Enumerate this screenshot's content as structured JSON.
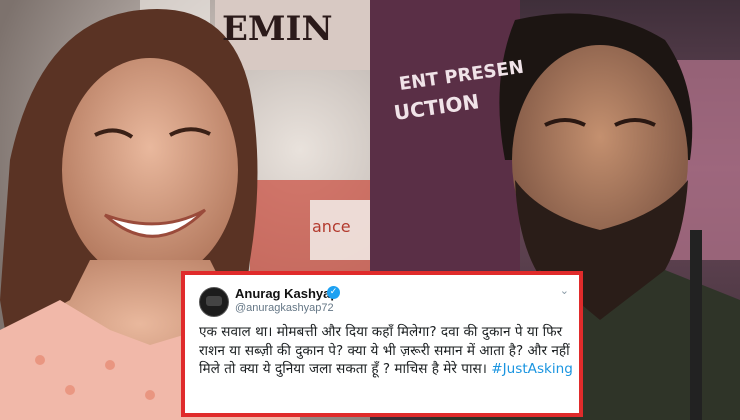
{
  "photo": {
    "background_banner_left": "EMIN",
    "background_banner_mid": "ENT PRESEN",
    "background_banner_low": "UCTION",
    "background_sign": "ance"
  },
  "tweet": {
    "author_name": "Anurag Kashyap",
    "verified_icon": "verified-badge-icon",
    "handle": "@anuragkashyap72",
    "text": "एक सवाल था। मोमबत्ती और दिया कहाँ मिलेगा? दवा की दुकान पे या फिर राशन या सब्ज़ी की दुकान पे? क्या ये भी ज़रूरी समान में आता है? और नहीं मिले तो क्या ये दुनिया जला सकता हूँ ? माचिस है मेरे पास।",
    "hashtag": "#JustAsking"
  },
  "colors": {
    "card_border": "#e02b2b",
    "hashtag": "#1b95e0",
    "verified": "#1da1f2"
  }
}
